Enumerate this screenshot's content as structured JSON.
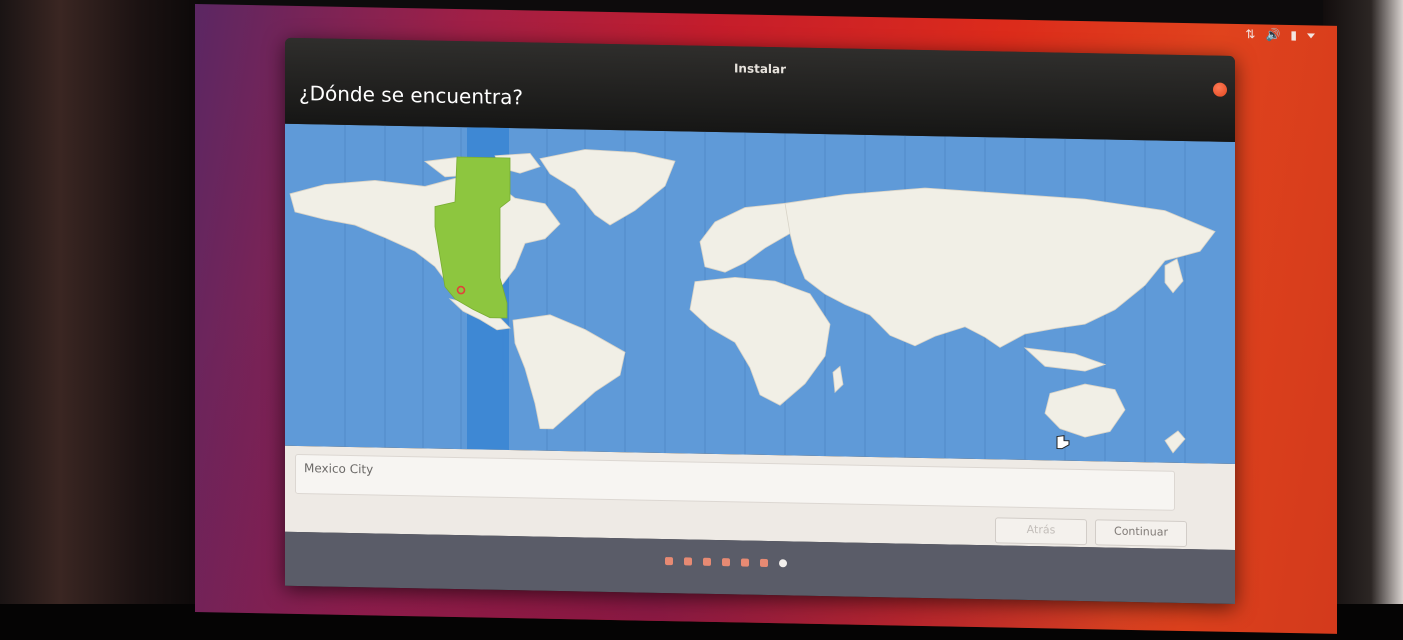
{
  "window": {
    "title": "Instalar",
    "heading": "¿Dónde se encuentra?"
  },
  "map": {
    "selected_timezone_band": "selected",
    "ocean_color": "#5f9ad8",
    "land_color": "#f1efe6",
    "selected_region_color": "#8dc63f"
  },
  "location": {
    "value": "Mexico City"
  },
  "buttons": {
    "back_label": "Atrás",
    "continue_label": "Continuar"
  },
  "progress": {
    "total_steps": 7,
    "current_step": 7
  },
  "accent_color": "#e95420"
}
